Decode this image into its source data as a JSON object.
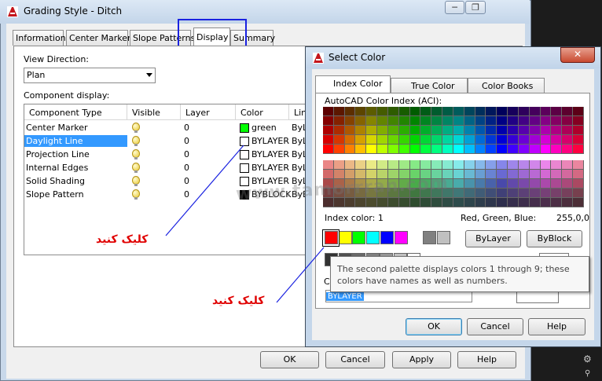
{
  "main_window": {
    "title": "Grading Style - Ditch",
    "tabs": [
      "Information",
      "Center Marker",
      "Slope Patterns",
      "Display",
      "Summary"
    ],
    "view_direction_label": "View Direction:",
    "view_direction_value": "Plan",
    "component_display_label": "Component display:",
    "columns": [
      "Component Type",
      "Visible",
      "Layer",
      "Color",
      "Lin"
    ],
    "rows": [
      {
        "type": "Center Marker",
        "layer": "0",
        "color_name": "green",
        "color_hex": "#00ff00",
        "linetype": "ByL"
      },
      {
        "type": "Daylight Line",
        "layer": "0",
        "color_name": "BYLAYER",
        "color_hex": "#ffffff",
        "linetype": "ByL"
      },
      {
        "type": "Projection Line",
        "layer": "0",
        "color_name": "BYLAYER",
        "color_hex": "#ffffff",
        "linetype": "ByL"
      },
      {
        "type": "Internal Edges",
        "layer": "0",
        "color_name": "BYLAYER",
        "color_hex": "#ffffff",
        "linetype": "ByL"
      },
      {
        "type": "Solid Shading",
        "layer": "0",
        "color_name": "BYLAYER",
        "color_hex": "#ffffff",
        "linetype": "ByL"
      },
      {
        "type": "Slope Pattern",
        "layer": "0",
        "color_name": "BYBLOCK",
        "color_hex": "#000000",
        "linetype": "ByB"
      }
    ],
    "selected_row": 1,
    "buttons": {
      "ok": "OK",
      "cancel": "Cancel",
      "apply": "Apply",
      "help": "Help"
    },
    "minimize_icon": "minimize-icon",
    "restore_icon": "restore-icon"
  },
  "select_color": {
    "title": "Select Color",
    "tabs": [
      "Index Color",
      "True Color",
      "Color Books"
    ],
    "aci_label": "AutoCAD Color Index (ACI):",
    "index_color_label": "Index color:",
    "index_color_value": "1",
    "rgb_label": "Red, Green, Blue:",
    "rgb_value": "255,0,0",
    "standard_colors": [
      "#ff0000",
      "#ffff00",
      "#00ff00",
      "#00ffff",
      "#0000ff",
      "#ff00ff",
      "#808080",
      "#c0c0c0"
    ],
    "gray_colors": [
      "#333333",
      "#505050",
      "#696969",
      "#808080",
      "#969696",
      "#c0c0c0",
      "#ffffff"
    ],
    "bylayer_button": "ByLayer",
    "byblock_button": "ByBlock",
    "color_label": "C",
    "color_value": "BYLAYER",
    "tooltip": "The second palette displays colors 1 through 9; these colors have names as well as numbers.",
    "buttons": {
      "ok": "OK",
      "cancel": "Cancel",
      "help": "Help"
    },
    "close_icon": "close-icon"
  },
  "annotations": {
    "click_1": "کلیک کنید",
    "click_2": "کلیک کنید",
    "watermark": "www.tamorrran.com"
  },
  "highlight_color": "#0000ff",
  "selection_color": "#3399ff"
}
